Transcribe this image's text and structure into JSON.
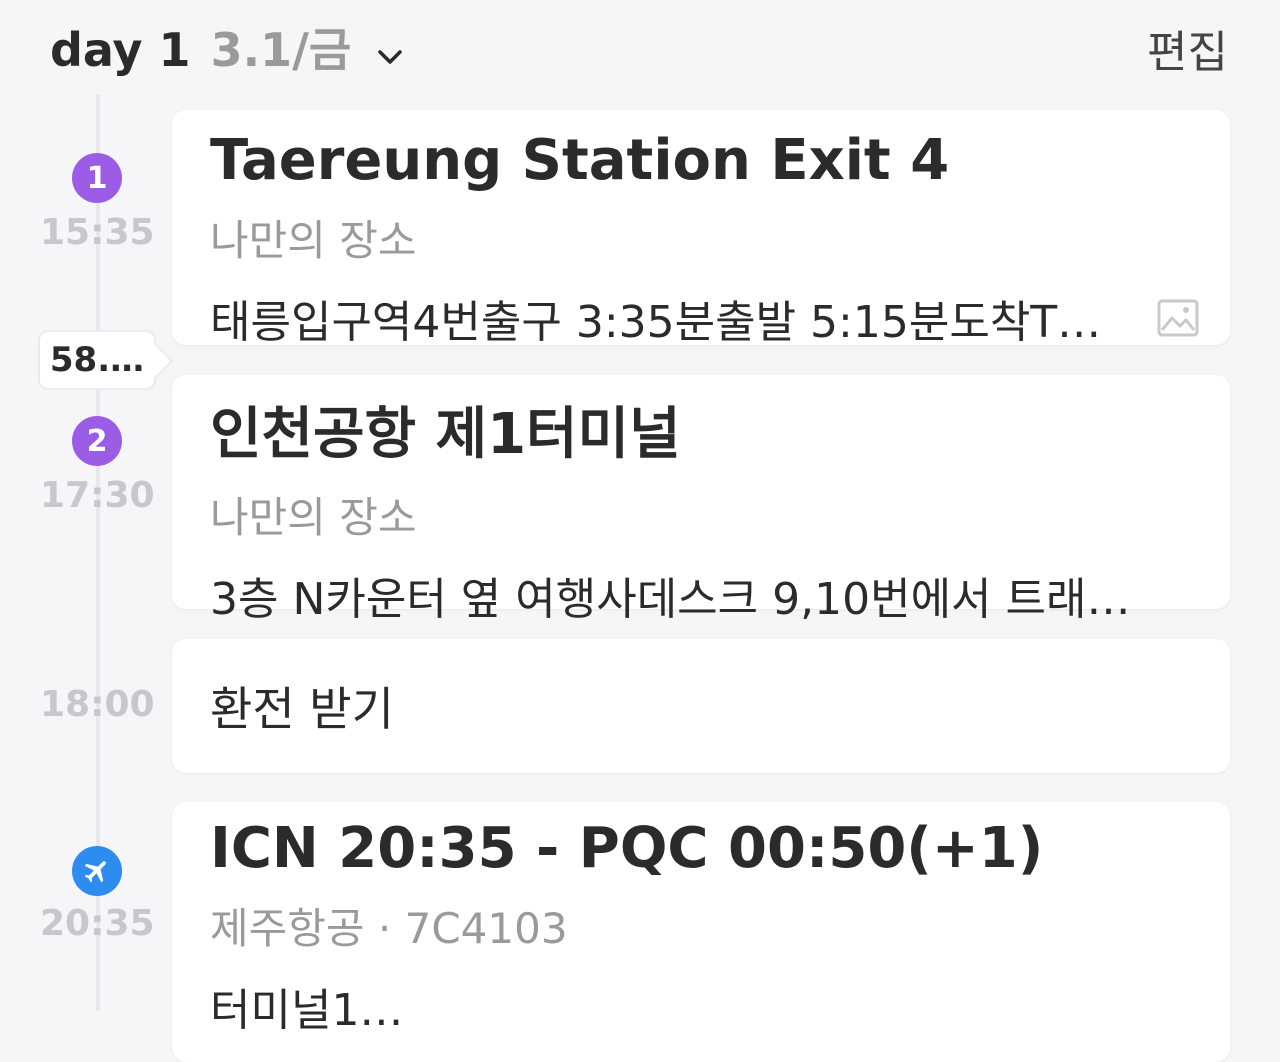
{
  "header": {
    "day_label": "day 1",
    "date_label": "3.1/금",
    "edit_label": "편집"
  },
  "items": [
    {
      "marker": "1",
      "time": "15:35",
      "title": "Taereung Station Exit 4",
      "subtitle": "나만의 장소",
      "memo": "태릉입구역4번출구 3:35분출발 5:15분도착T…",
      "memo_icon": "image-icon"
    },
    {
      "distance_tag": "58.…",
      "marker": "2",
      "time": "17:30",
      "title": "인천공항 제1터미널",
      "subtitle": "나만의 장소",
      "memo": "3층 N카운터 옆 여행사데스크 9,10번에서 트래…"
    },
    {
      "time": "18:00",
      "text": "환전 받기"
    },
    {
      "marker_icon": "airplane-icon",
      "time": "20:35",
      "title": "ICN 20:35 - PQC 00:50(+1)",
      "subtitle": "제주항공 · 7C4103",
      "memo": "터미널1…"
    }
  ],
  "colors": {
    "place_marker": "#9b5de5",
    "flight_marker": "#2d8cf0",
    "time_text": "#c7c7cc",
    "subtitle_text": "#9a9a9a"
  }
}
